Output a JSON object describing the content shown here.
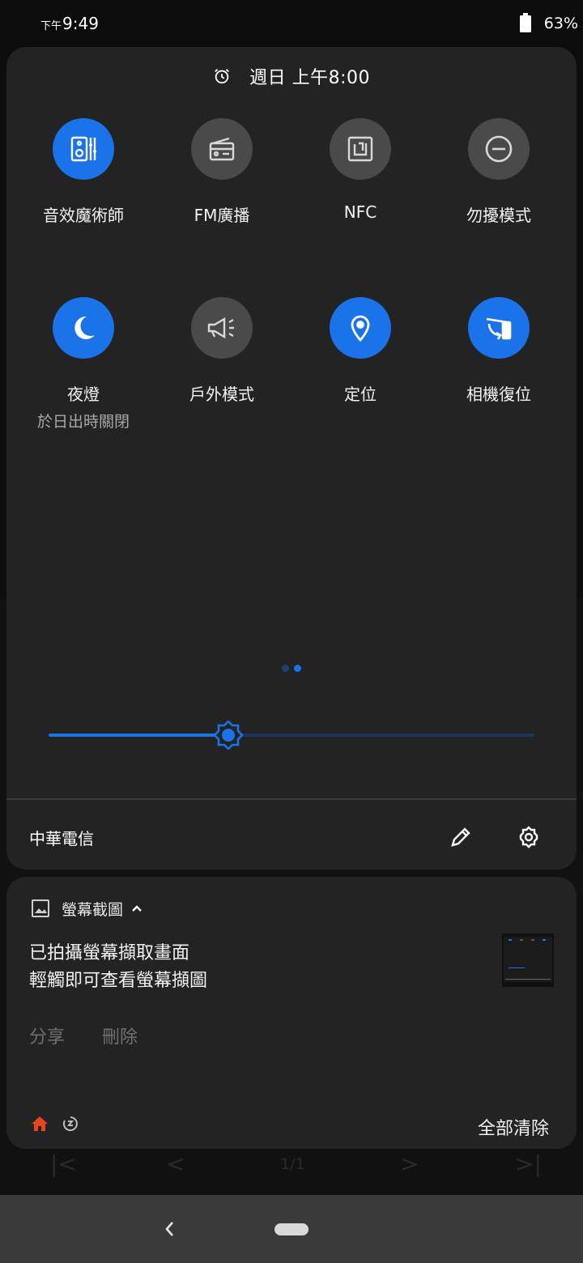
{
  "status_bar": {
    "period": "下午",
    "time": "9:49",
    "battery_percent": "63%"
  },
  "quick_settings": {
    "alarm_text": "週日 上午8:00",
    "tiles": [
      {
        "label": "音效魔術師",
        "icon": "audio-wizard-icon",
        "on": true
      },
      {
        "label": "FM廣播",
        "icon": "radio-icon",
        "on": false
      },
      {
        "label": "NFC",
        "icon": "nfc-icon",
        "on": false
      },
      {
        "label": "勿擾模式",
        "icon": "do-not-disturb-icon",
        "on": false
      },
      {
        "label": "夜燈",
        "sub": "於日出時關閉",
        "icon": "moon-icon",
        "on": true
      },
      {
        "label": "戶外模式",
        "icon": "megaphone-icon",
        "on": false
      },
      {
        "label": "定位",
        "icon": "location-icon",
        "on": true
      },
      {
        "label": "相機復位",
        "icon": "camera-reset-icon",
        "on": true
      }
    ],
    "page_count": 2,
    "current_page": 2,
    "brightness_fraction": 0.37,
    "carrier": "中華電信"
  },
  "notification": {
    "app_name": "螢幕截圖",
    "title": "已拍攝螢幕擷取畫面",
    "body": "輕觸即可查看螢幕擷圖",
    "actions": [
      "分享",
      "刪除"
    ],
    "clear_all": "全部清除"
  },
  "background_app": {
    "page_indicator": "1/1"
  },
  "colors": {
    "accent": "#1a73e8",
    "panel": "#232323",
    "tile_off": "#4a4a4a",
    "home_icon": "#e8451e"
  }
}
